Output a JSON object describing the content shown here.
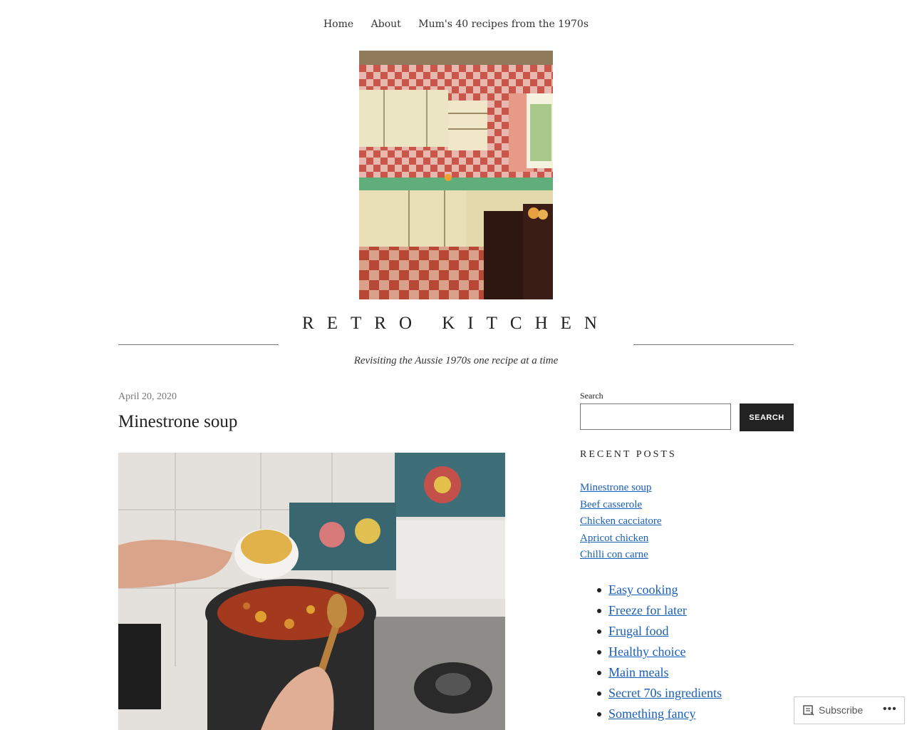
{
  "nav": {
    "items": [
      "Home",
      "About",
      "Mum's 40 recipes from the 1970s"
    ]
  },
  "site": {
    "title": "RETRO KITCHEN",
    "tagline": "Revisiting the Aussie 1970s one recipe at a time"
  },
  "post": {
    "date": "April 20, 2020",
    "title": "Minestrone soup"
  },
  "sidebar": {
    "search_label": "Search",
    "search_button": "SEARCH",
    "recent_posts_title": "RECENT POSTS",
    "recent_posts": [
      "Minestrone soup",
      "Beef casserole",
      "Chicken cacciatore",
      "Apricot chicken",
      "Chilli con carne"
    ],
    "categories": [
      "Easy cooking",
      "Freeze for later",
      "Frugal food",
      "Healthy choice",
      "Main meals",
      "Secret 70s ingredients",
      "Something fancy"
    ]
  },
  "footer_bar": {
    "subscribe": "Subscribe",
    "more": "•••"
  },
  "colors": {
    "link": "#1a5fb4",
    "button_bg": "#222222",
    "rule": "#777777"
  }
}
